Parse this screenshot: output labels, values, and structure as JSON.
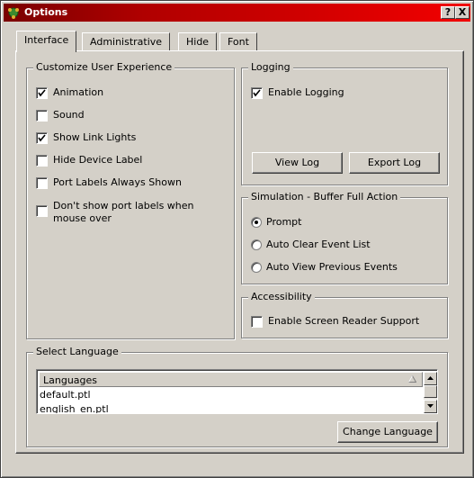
{
  "window": {
    "title": "Options",
    "help_label": "?",
    "close_label": "X"
  },
  "tabs": [
    {
      "label": "Interface",
      "active": true
    },
    {
      "label": "Administrative",
      "active": false
    },
    {
      "label": "Hide",
      "active": false
    },
    {
      "label": "Font",
      "active": false
    }
  ],
  "customize": {
    "title": "Customize User Experience",
    "options": [
      {
        "label": "Animation",
        "checked": true
      },
      {
        "label": "Sound",
        "checked": false
      },
      {
        "label": "Show Link Lights",
        "checked": true
      },
      {
        "label": "Hide Device Label",
        "checked": false
      },
      {
        "label": "Port Labels Always Shown",
        "checked": false
      },
      {
        "label_line1": "Don't show port labels when",
        "label_line2": "mouse over",
        "checked": false
      }
    ]
  },
  "logging": {
    "title": "Logging",
    "enable_label": "Enable Logging",
    "enable_checked": true,
    "view_log_label": "View Log",
    "export_log_label": "Export Log"
  },
  "simulation": {
    "title": "Simulation - Buffer Full Action",
    "options": [
      {
        "label": "Prompt",
        "selected": true
      },
      {
        "label": "Auto Clear Event List",
        "selected": false
      },
      {
        "label": "Auto View Previous Events",
        "selected": false
      }
    ]
  },
  "accessibility": {
    "title": "Accessibility",
    "screen_reader_label": "Enable Screen Reader Support",
    "screen_reader_checked": false
  },
  "language": {
    "title": "Select Language",
    "column_header": "Languages",
    "items": [
      "default.ptl",
      "english_en.ptl"
    ],
    "change_label": "Change Language"
  },
  "colors": {
    "titlebar_start": "#7a0000",
    "titlebar_end": "#f20000",
    "face": "#d4d0c8"
  },
  "icons": {
    "app": "packet-tracer-icon",
    "check": "check-icon",
    "sort": "sort-triangle-icon",
    "scroll_up": "arrow-up-icon",
    "scroll_down": "arrow-down-icon"
  }
}
